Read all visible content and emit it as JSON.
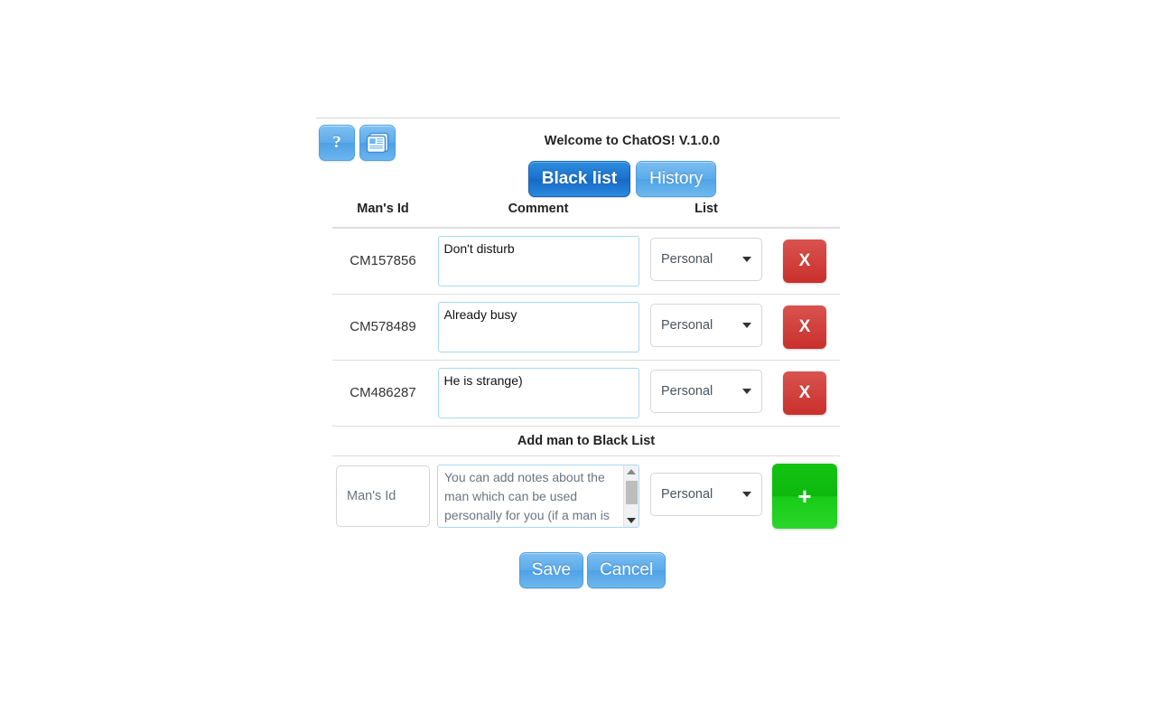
{
  "header": {
    "help_icon": "question-mark-icon",
    "news_icon": "newspaper-icon",
    "welcome": "Welcome to ChatOS! V.1.0.0"
  },
  "tabs": [
    {
      "label": "Black list",
      "active": true
    },
    {
      "label": "History",
      "active": false
    }
  ],
  "table": {
    "columns": [
      "Man's Id",
      "Comment",
      "List"
    ],
    "rows": [
      {
        "id": "CM157856",
        "comment": "Don't disturb",
        "list": "Personal",
        "delete_label": "X"
      },
      {
        "id": "CM578489",
        "comment": "Already busy",
        "list": "Personal",
        "delete_label": "X"
      },
      {
        "id": "CM486287",
        "comment": "He is strange)",
        "list": "Personal",
        "delete_label": "X"
      }
    ]
  },
  "add_section": {
    "title": "Add man to Black List",
    "id_placeholder": "Man's Id",
    "note_placeholder": "You can add notes about the man which can be used personally for you (if a man is added to your Personal",
    "list_value": "Personal",
    "add_label": "+"
  },
  "footer": {
    "save_label": "Save",
    "cancel_label": "Cancel"
  },
  "colors": {
    "tab_active": "#1a71cc",
    "tab_inactive": "#5aabea",
    "delete_red": "#c9302c",
    "add_green": "#12c412",
    "textarea_border": "#a9d8ef",
    "rule": "#dddddd"
  }
}
